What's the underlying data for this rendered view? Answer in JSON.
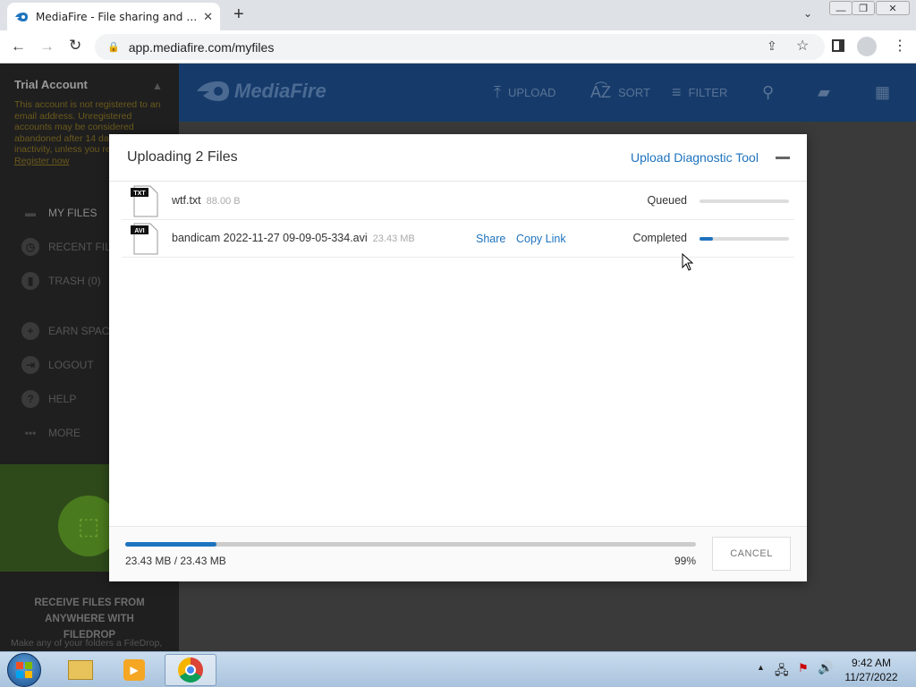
{
  "browser": {
    "tab_title": "MediaFire - File sharing and storage",
    "new_tab_icon": "+",
    "url": "app.mediafire.com/myfiles"
  },
  "sidebar": {
    "account_title": "Trial Account",
    "warning_text": "This account is not registered to an email address. Unregistered accounts may be considered abandoned after 14 days of inactivity, unless you register.",
    "register_link": "Register now",
    "items": [
      {
        "label": "MY FILES",
        "icon": "folder-icon"
      },
      {
        "label": "RECENT FILES",
        "icon": "clock-icon"
      },
      {
        "label": "TRASH (0)",
        "icon": "trash-icon"
      },
      {
        "label": "EARN SPACE",
        "icon": "plus-circle-icon"
      },
      {
        "label": "LOGOUT",
        "icon": "logout-icon"
      },
      {
        "label": "HELP",
        "icon": "help-icon"
      },
      {
        "label": "MORE",
        "icon": "ellipsis-icon"
      }
    ],
    "promo_title": "RECEIVE FILES FROM ANYWHERE WITH FILEDROP",
    "promo_text": "Make any of your folders a FileDrop,"
  },
  "header": {
    "logo": "MediaFire",
    "upload": "UPLOAD",
    "sort": "SORT",
    "filter": "FILTER",
    "sort_icon_text": "A͡Z"
  },
  "modal": {
    "title": "Uploading 2 Files",
    "diagnostic_link": "Upload Diagnostic Tool",
    "files": [
      {
        "type": "TXT",
        "name": "wtf.txt",
        "size": "88.00 B",
        "status": "Queued",
        "progress": 0
      },
      {
        "type": "AVI",
        "name": "bandicam 2022-11-27 09-09-05-334.avi",
        "size": "23.43 MB",
        "status": "Completed",
        "progress": 0.15,
        "share": "Share",
        "copy_link": "Copy Link"
      }
    ],
    "total_text": "23.43 MB / 23.43 MB",
    "percent": "99%",
    "overall_progress": 0.16,
    "cancel": "CANCEL"
  },
  "taskbar": {
    "time": "9:42 AM",
    "date": "11/27/2022"
  },
  "colors": {
    "accent": "#1e73be",
    "header": "#163b6b",
    "sidebar": "#1f1f1f"
  }
}
